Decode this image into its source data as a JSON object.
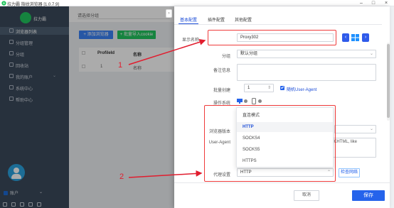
{
  "window": {
    "title": "拉力霸 指纹浏览器 [1.0.7.9]",
    "controls": [
      "–",
      "□",
      "×"
    ]
  },
  "sidebar": {
    "brand": "拉力霸",
    "items": [
      {
        "label": "浏览器列表",
        "icon": "list-icon"
      },
      {
        "label": "分组管理",
        "icon": "folder-icon"
      },
      {
        "label": "分组",
        "icon": "group-icon"
      },
      {
        "label": "回收站",
        "icon": "trash-icon"
      },
      {
        "label": "我的账户",
        "icon": "user-icon"
      },
      {
        "label": "系统中心",
        "icon": "settings-icon"
      },
      {
        "label": "帮助中心",
        "icon": "help-icon"
      }
    ],
    "account_label": "账户"
  },
  "main": {
    "group_select": "请选择分组",
    "add_button": "+ 添加浏览器",
    "batch_button": "+ 批量导入cookie",
    "table_headers": [
      "ProfileId",
      "名称"
    ],
    "table_cells": [
      "1",
      "名称"
    ]
  },
  "drawer": {
    "tabs": [
      "基本配置",
      "插件配置",
      "其他配置"
    ],
    "labels": {
      "display_name": "显示名称",
      "group": "分组",
      "remark": "备注信息",
      "open_count": "批量创建",
      "os": "操作系统",
      "browser_version": "浏览器版本",
      "user_agent": "User-Agent",
      "proxy_settings": "代理设置"
    },
    "values": {
      "display_name": "Proxy302",
      "group": "默认分组",
      "open_count": "1",
      "user_agent_tail": "7.36 (KHTML, like",
      "proxy_settings": "HTTP"
    },
    "random_ua_label": "随机User-Agent",
    "check_proxy_button": "检查网络",
    "collapse_icon": "›"
  },
  "proxy_dropdown": {
    "options": [
      "直连模式",
      "HTTP",
      "SOCKS4",
      "SOCKS5",
      "HTTPS"
    ],
    "selected": "HTTP"
  },
  "footer": {
    "cancel": "取消",
    "save": "保存"
  },
  "annotations": {
    "marker_1": "1",
    "marker_2": "2",
    "color": "#e11d2e"
  }
}
